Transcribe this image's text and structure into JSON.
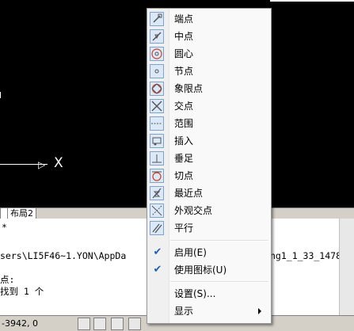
{
  "layout_tabs": [
    "",
    "布局2"
  ],
  "command_lines": [
    "*",
    "sers\\LI5F46~1.YON\\AppDa",
    "ng1_1_33_1478.",
    "点:",
    "找到 1 个"
  ],
  "axis_label": "X",
  "status": {
    "coords": "-3942, 0"
  },
  "snap_menu": {
    "items": [
      {
        "label": "端点",
        "icon": "endpoint-icon"
      },
      {
        "label": "中点",
        "icon": "midpoint-icon"
      },
      {
        "label": "圆心",
        "icon": "center-icon"
      },
      {
        "label": "节点",
        "icon": "node-icon"
      },
      {
        "label": "象限点",
        "icon": "quadrant-icon"
      },
      {
        "label": "交点",
        "icon": "intersection-icon"
      },
      {
        "label": "范围",
        "icon": "extension-icon"
      },
      {
        "label": "插入",
        "icon": "insert-icon"
      },
      {
        "label": "垂足",
        "icon": "perpendicular-icon"
      },
      {
        "label": "切点",
        "icon": "tangent-icon"
      },
      {
        "label": "最近点",
        "icon": "nearest-icon"
      },
      {
        "label": "外观交点",
        "icon": "apparent-intersection-icon"
      },
      {
        "label": "平行",
        "icon": "parallel-icon"
      }
    ],
    "toggles": [
      {
        "label": "启用(E)",
        "checked": true
      },
      {
        "label": "使用图标(U)",
        "checked": true
      }
    ],
    "settings_label": "设置(S)...",
    "display_label": "显示"
  }
}
